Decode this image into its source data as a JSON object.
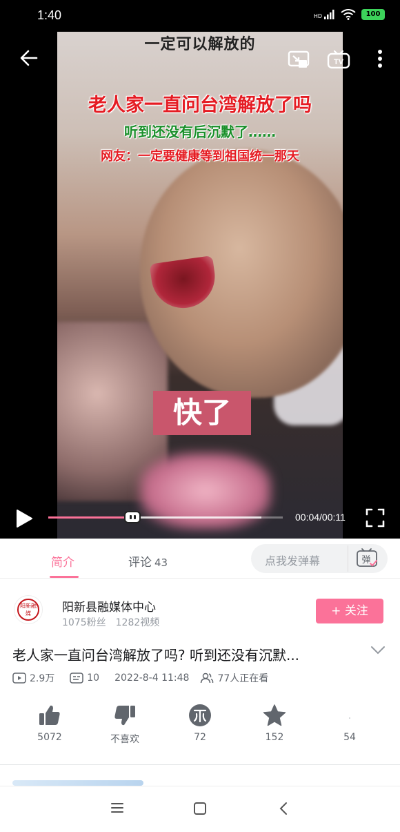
{
  "status": {
    "time": "1:40",
    "battery": "100",
    "network": "HD"
  },
  "video": {
    "top_subtitle": "一定可以解放的",
    "headline1": "老人家一直问台湾解放了吗",
    "headline2": "听到还没有后沉默了……",
    "headline3": "网友：一定要健康等到祖国统一那天",
    "caption": "快了",
    "time_display": "00:04/00:11",
    "progress_fraction": 0.36
  },
  "tabs": {
    "intro": "简介",
    "comments": "评论",
    "comments_count": "43",
    "danmaku_placeholder": "点我发弹幕",
    "danmaku_button": "弹"
  },
  "uploader": {
    "name": "阳新县融媒体中心",
    "fans": "1075粉丝",
    "videos": "1282视频",
    "follow_label": "+ 关注",
    "avatar_text": "阳新融媒"
  },
  "video_info": {
    "title": "老人家一直问台湾解放了吗? 听到还没有沉默...",
    "plays": "2.9万",
    "danmaku_count": "10",
    "date": "2022-8-4 11:48",
    "watching": "77人正在看"
  },
  "actions": {
    "like": "5072",
    "dislike": "不喜欢",
    "coin": "72",
    "favorite": "152",
    "share": "54"
  },
  "colors": {
    "accent": "#fb7299",
    "caption_bg": "#c9566c",
    "headline_red": "#e51c23",
    "headline_green": "#1a8f2a"
  }
}
